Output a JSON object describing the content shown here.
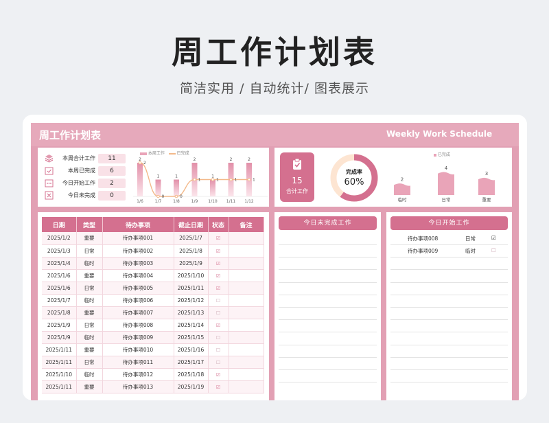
{
  "hero": {
    "title": "周工作计划表",
    "subtitle": "简洁实用 / 自动统计/ 图表展示"
  },
  "sheet": {
    "title": "周工作计划表",
    "title_en": "Weekly Work Schedule"
  },
  "stats": [
    {
      "label": "本周合计工作",
      "value": "11",
      "icon": "layers-icon"
    },
    {
      "label": "本周已完成",
      "value": "6",
      "icon": "calendar-check-icon"
    },
    {
      "label": "今日开始工作",
      "value": "2",
      "icon": "calendar-dots-icon"
    },
    {
      "label": "今日未完成",
      "value": "0",
      "icon": "x-box-icon"
    }
  ],
  "colors": {
    "accent": "#d4708f",
    "sheet": "#e2a0b4",
    "bar": "#e9a4b8",
    "line": "#f3b98a"
  },
  "chart_data": [
    {
      "type": "bar",
      "categories": [
        "1/6",
        "1/7",
        "1/8",
        "1/9",
        "1/10",
        "1/11",
        "1/12"
      ],
      "series": [
        {
          "name": "本周工作",
          "values": [
            2,
            1,
            1,
            2,
            1,
            2,
            2
          ]
        },
        {
          "name": "已完成",
          "values": [
            2,
            0,
            0,
            1,
            1,
            1,
            1
          ]
        }
      ],
      "data_labels": [
        "2",
        "1",
        "1",
        "2",
        "1",
        "2",
        "2"
      ],
      "line_labels": [
        "2",
        "0",
        "0",
        "1",
        "1",
        "1",
        "1"
      ],
      "legend": "top"
    },
    {
      "type": "pie",
      "center_label": "完成率",
      "center_value": "60%",
      "values": [
        60,
        40
      ]
    },
    {
      "type": "area",
      "legend_entries": [
        "已完成"
      ],
      "categories": [
        "临时",
        "日常",
        "重要"
      ],
      "values": [
        2,
        4,
        3
      ]
    }
  ],
  "total": {
    "value": "15",
    "label": "合计工作"
  },
  "table": {
    "headers": [
      "日期",
      "类型",
      "待办事项",
      "截止日期",
      "状态",
      "备注"
    ],
    "rows": [
      {
        "date": "2025/1/2",
        "type": "重要",
        "task": "待办事项001",
        "due": "2025/1/7",
        "done": true
      },
      {
        "date": "2025/1/3",
        "type": "日常",
        "task": "待办事项002",
        "due": "2025/1/8",
        "done": true
      },
      {
        "date": "2025/1/4",
        "type": "临时",
        "task": "待办事项003",
        "due": "2025/1/9",
        "done": true
      },
      {
        "date": "2025/1/6",
        "type": "重要",
        "task": "待办事项004",
        "due": "2025/1/10",
        "done": true
      },
      {
        "date": "2025/1/6",
        "type": "日常",
        "task": "待办事项005",
        "due": "2025/1/11",
        "done": true
      },
      {
        "date": "2025/1/7",
        "type": "临时",
        "task": "待办事项006",
        "due": "2025/1/12",
        "done": false
      },
      {
        "date": "2025/1/8",
        "type": "重要",
        "task": "待办事项007",
        "due": "2025/1/13",
        "done": false
      },
      {
        "date": "2025/1/9",
        "type": "日常",
        "task": "待办事项008",
        "due": "2025/1/14",
        "done": true
      },
      {
        "date": "2025/1/9",
        "type": "临时",
        "task": "待办事项009",
        "due": "2025/1/15",
        "done": false
      },
      {
        "date": "2025/1/11",
        "type": "重要",
        "task": "待办事项010",
        "due": "2025/1/16",
        "done": false
      },
      {
        "date": "2025/1/11",
        "type": "日常",
        "task": "待办事项011",
        "due": "2025/1/17",
        "done": false
      },
      {
        "date": "2025/1/10",
        "type": "临时",
        "task": "待办事项012",
        "due": "2025/1/18",
        "done": true
      },
      {
        "date": "2025/1/11",
        "type": "重要",
        "task": "待办事项013",
        "due": "2025/1/19",
        "done": true
      }
    ]
  },
  "undone": {
    "title": "今日未完成工作"
  },
  "started": {
    "title": "今日开始工作",
    "items": [
      {
        "task": "待办事项008",
        "type": "日常",
        "done": true
      },
      {
        "task": "待办事项009",
        "type": "临时",
        "done": false
      }
    ]
  }
}
